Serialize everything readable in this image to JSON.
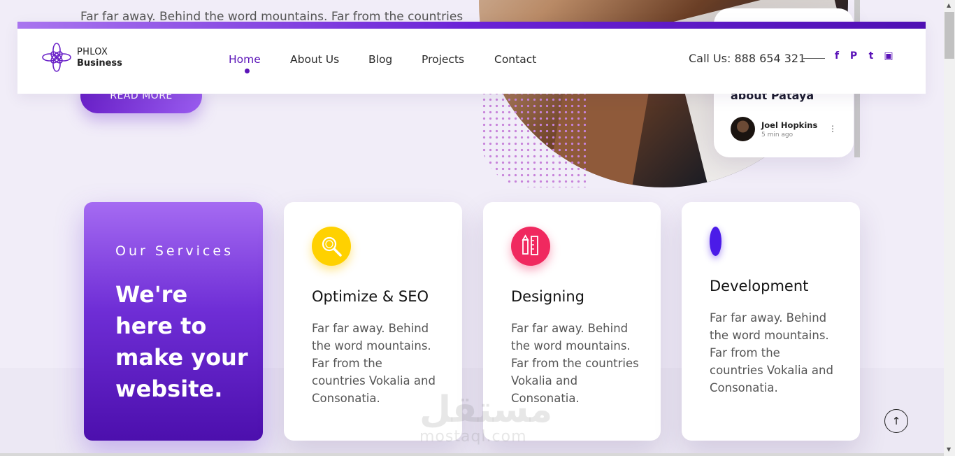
{
  "hero": {
    "text": "Far far away. Behind the word mountains. Far from the countries",
    "button_label": "READ MORE"
  },
  "post_card": {
    "title": "about Pataya",
    "author": "Joel Hopkins",
    "time": "5 min ago"
  },
  "header": {
    "logo_line1": "PHLOX",
    "logo_line2": "Business",
    "nav": [
      "Home",
      "About Us",
      "Blog",
      "Projects",
      "Contact"
    ],
    "active_index": 0,
    "call": "Call Us: 888 654 321",
    "social": [
      "facebook-icon",
      "pinterest-icon",
      "twitter-icon",
      "youtube-icon"
    ],
    "social_glyphs": [
      "f",
      "P",
      "t",
      "▣"
    ]
  },
  "services": {
    "eyebrow": "Our Services",
    "heading": "We're here to make your website.",
    "cards": [
      {
        "title": "Optimize & SEO",
        "text": "Far far away. Behind the word mountains. Far from the countries Vokalia and Consonatia.",
        "icon": "magnifier-icon",
        "color": "#ffd100"
      },
      {
        "title": "Designing",
        "text": "Far far away. Behind the word mountains. Far from the countries Vokalia and Consonatia.",
        "icon": "pencil-ruler-icon",
        "color": "#f0295f"
      },
      {
        "title": "Development",
        "text": "Far far away. Behind the word mountains. Far from the countries Vokalia and Consonatia.",
        "icon": "dev-icon",
        "color": "#4b1be8"
      }
    ]
  },
  "watermark": {
    "arabic": "مستقل",
    "latin": "mostaql.com"
  },
  "scroll_top_glyph": "↑"
}
